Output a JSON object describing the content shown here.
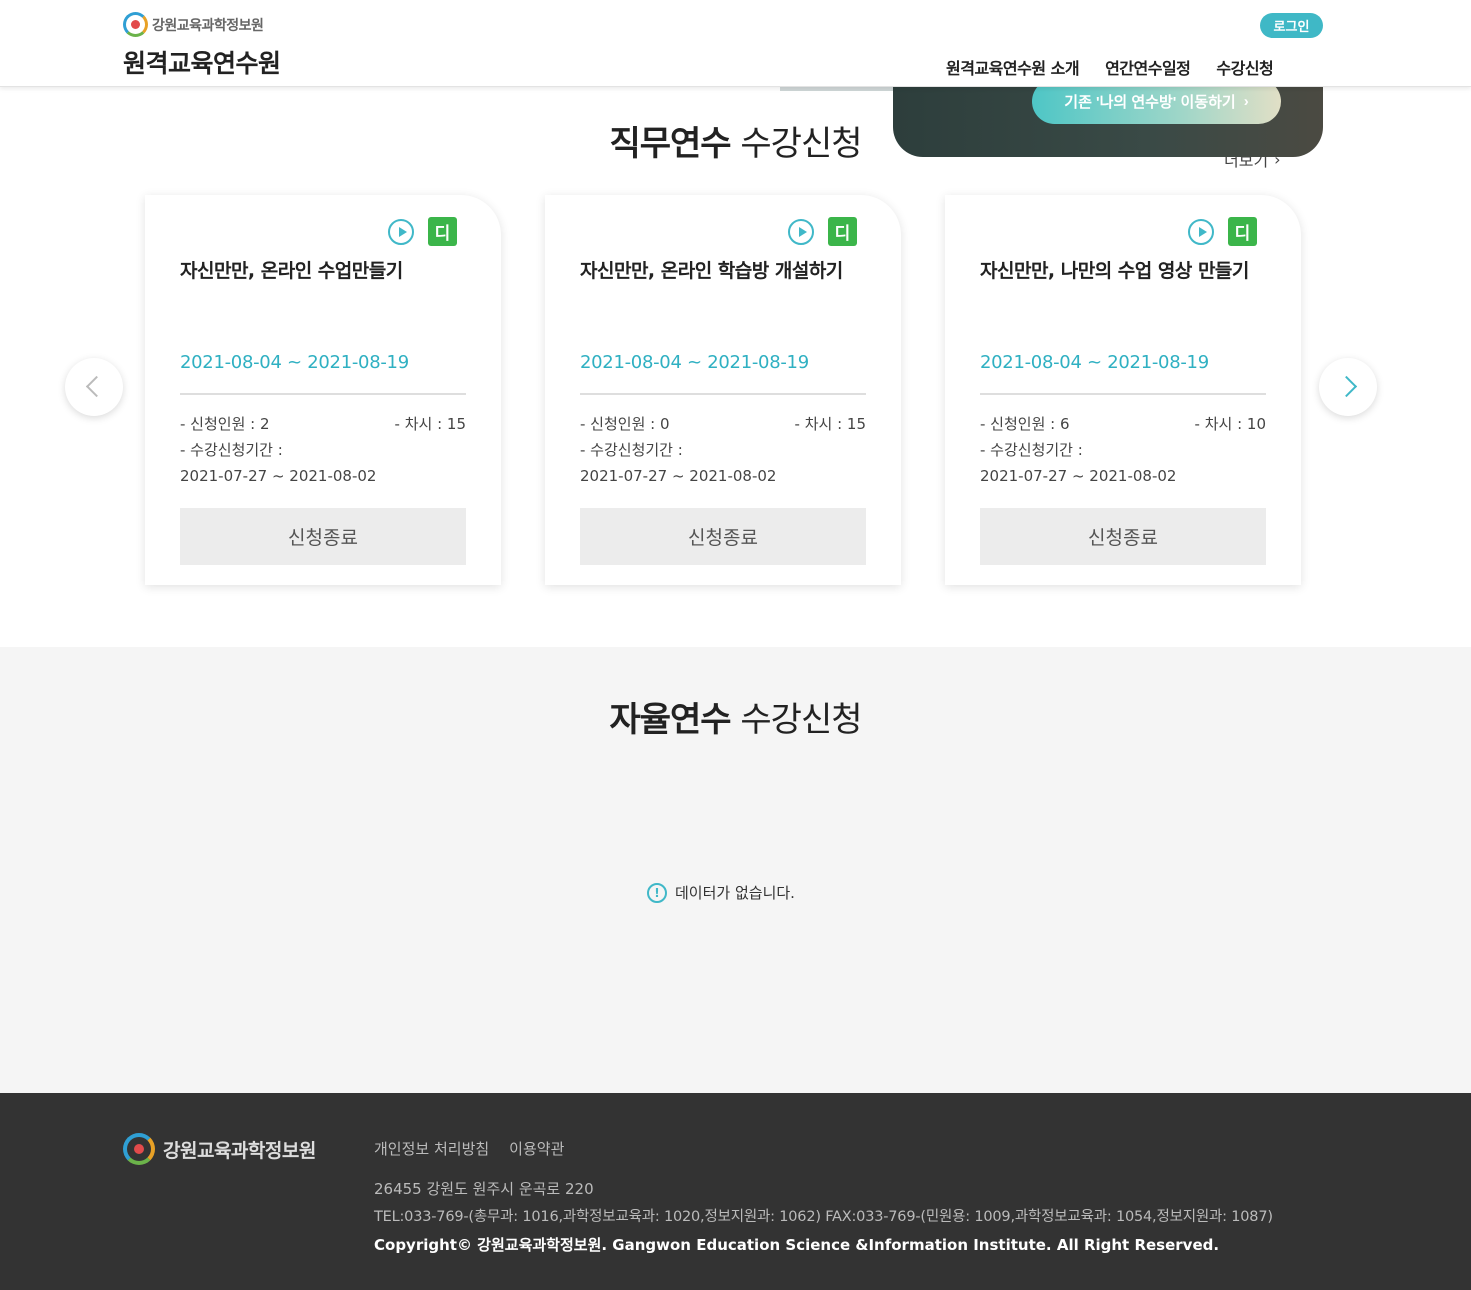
{
  "header": {
    "org_name": "강원교육과학정보원",
    "site_title": "원격교육연수원",
    "login_label": "로그인",
    "nav": [
      {
        "label": "원격교육연수원 소개"
      },
      {
        "label": "연간연수일정"
      },
      {
        "label": "수강신청"
      }
    ]
  },
  "banner": {
    "button_label": "기존 '나의 연수방' 이동하기",
    "button_arrow": "›"
  },
  "job_training": {
    "title_bold": "직무연수",
    "title_rest": " 수강신청",
    "more_label": "더보기",
    "more_arrow": "›",
    "prev_label": "‹",
    "next_label": "›",
    "cards": [
      {
        "badge": "디",
        "title": "자신만만, 온라인 수업만들기",
        "period": "2021-08-04 ~ 2021-08-19",
        "applicants": "- 신청인원 : 2",
        "sessions": "- 차시 : 15",
        "apply_period_label": "- 수강신청기간 :",
        "apply_period": "2021-07-27 ~ 2021-08-02",
        "button": "신청종료"
      },
      {
        "badge": "디",
        "title": "자신만만, 온라인 학습방 개설하기",
        "period": "2021-08-04 ~ 2021-08-19",
        "applicants": "- 신청인원 : 0",
        "sessions": "- 차시 : 15",
        "apply_period_label": "- 수강신청기간 :",
        "apply_period": "2021-07-27 ~ 2021-08-02",
        "button": "신청종료"
      },
      {
        "badge": "디",
        "title": "자신만만, 나만의 수업 영상 만들기",
        "period": "2021-08-04 ~ 2021-08-19",
        "applicants": "- 신청인원 : 6",
        "sessions": "- 차시 : 10",
        "apply_period_label": "- 수강신청기간 :",
        "apply_period": "2021-07-27 ~ 2021-08-02",
        "button": "신청종료"
      }
    ]
  },
  "self_training": {
    "title_bold": "자율연수",
    "title_rest": " 수강신청",
    "empty_icon": "!",
    "empty_message": "데이터가 없습니다."
  },
  "footer": {
    "org_name": "강원교육과학정보원",
    "links": [
      {
        "label": "개인정보 처리방침"
      },
      {
        "label": "이용약관"
      }
    ],
    "address": "26455 강원도 원주시 운곡로 220",
    "tel": "TEL:033-769-(총무과: 1016,과학정보교육과: 1020,정보지원과: 1062) FAX:033-769-(민원용: 1009,과학정보교육과: 1054,정보지원과: 1087)",
    "copyright": "Copyright© 강원교육과학정보원. Gangwon Education Science &Information Institute. All Right Reserved."
  },
  "colors": {
    "accent": "#3fb8c6",
    "badge_green": "#3bb54a",
    "footer_bg": "#333333",
    "section_gray": "#f5f5f5"
  }
}
